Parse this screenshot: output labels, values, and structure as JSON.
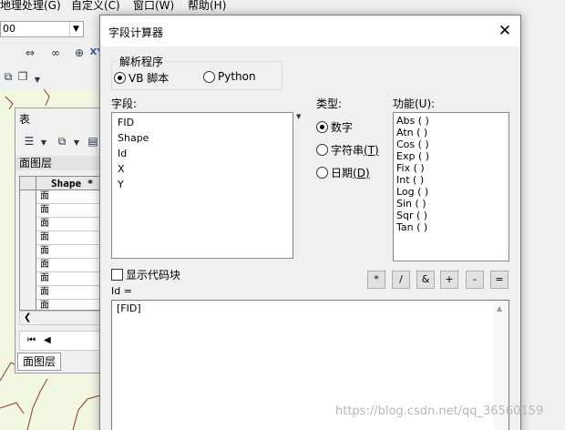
{
  "background": {
    "menu": [
      "地理处理(G)",
      "自定义(C)",
      "窗口(W)",
      "帮助(H)"
    ],
    "scale_value": "00",
    "table_panel": {
      "title": "表",
      "layer_name": "面图层",
      "column_header": "Shape *",
      "rows": [
        "面",
        "面",
        "面",
        "面",
        "面",
        "面",
        "面",
        "面",
        "面"
      ],
      "bottom_tab": "面图层"
    }
  },
  "dialog": {
    "title": "字段计算器",
    "parser_label": "解析程序",
    "parser_options": [
      {
        "label": "VB 脚本",
        "selected": true
      },
      {
        "label": "Python",
        "selected": false
      }
    ],
    "fields_label": "字段:",
    "fields": [
      "FID",
      "Shape",
      "Id",
      "X",
      "Y"
    ],
    "type_label": "类型:",
    "type_options": [
      {
        "label": "数字",
        "selected": true
      },
      {
        "label": "字符串",
        "accel": "(T)",
        "selected": false
      },
      {
        "label": "日期",
        "accel": "(D)",
        "selected": false
      }
    ],
    "functions_label": "功能(U):",
    "functions": [
      "Abs ( )",
      "Atn ( )",
      "Cos ( )",
      "Exp ( )",
      "Fix ( )",
      "Int ( )",
      "Log ( )",
      "Sin ( )",
      "Sqr ( )",
      "Tan ( )"
    ],
    "show_codeblock_label": "显示代码块",
    "show_codeblock_checked": false,
    "operators": [
      "*",
      "/",
      "&",
      "+",
      "-",
      "="
    ],
    "expression_label": "Id =",
    "expression_value": "[FID]"
  },
  "watermark": "https://blog.csdn.net/qq_36560159"
}
